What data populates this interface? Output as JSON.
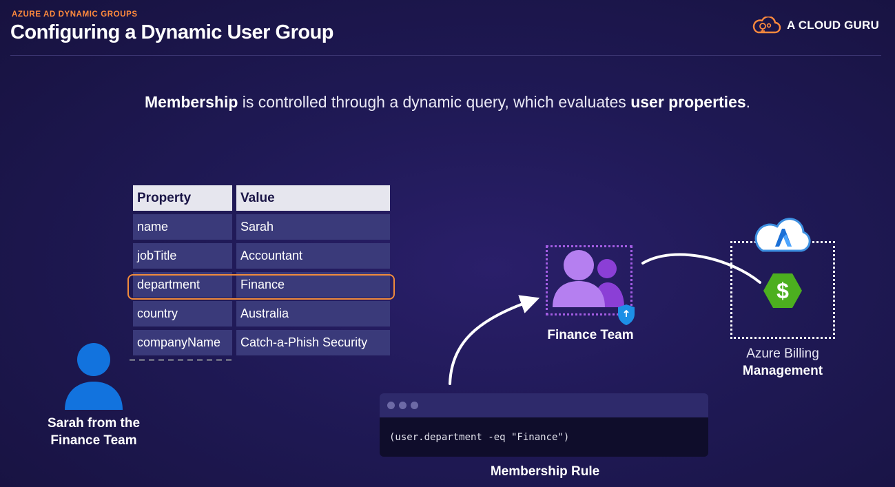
{
  "header": {
    "eyebrow": "AZURE AD DYNAMIC GROUPS",
    "title": "Configuring a Dynamic User Group",
    "brand": "A CLOUD GURU"
  },
  "subtitle": {
    "bold1": "Membership",
    "text1": " is controlled through a dynamic query, which evaluates ",
    "bold2": "user properties",
    "text2": "."
  },
  "table": {
    "headers": [
      "Property",
      "Value"
    ],
    "rows": [
      [
        "name",
        "Sarah"
      ],
      [
        "jobTitle",
        "Accountant"
      ],
      [
        "department",
        "Finance"
      ],
      [
        "country",
        "Australia"
      ],
      [
        "companyName",
        "Catch-a-Phish Security"
      ]
    ],
    "highlighted_row": 2
  },
  "user": {
    "label_line1": "Sarah from the",
    "label_line2": "Finance Team"
  },
  "group": {
    "label": "Finance Team"
  },
  "billing": {
    "line1": "Azure Billing",
    "line2": "Management"
  },
  "rule": {
    "code": "(user.department -eq \"Finance\")",
    "label": "Membership Rule"
  },
  "colors": {
    "background": "#1f1955",
    "accent_orange": "#f28b3b",
    "group_purple": "#a45de4",
    "user_blue": "#1273de",
    "dollar_green": "#4caf1f"
  },
  "icons": [
    "cloud-brand-icon",
    "user-icon",
    "group-icon",
    "shield-icon",
    "azure-cloud-icon",
    "dollar-icon"
  ]
}
